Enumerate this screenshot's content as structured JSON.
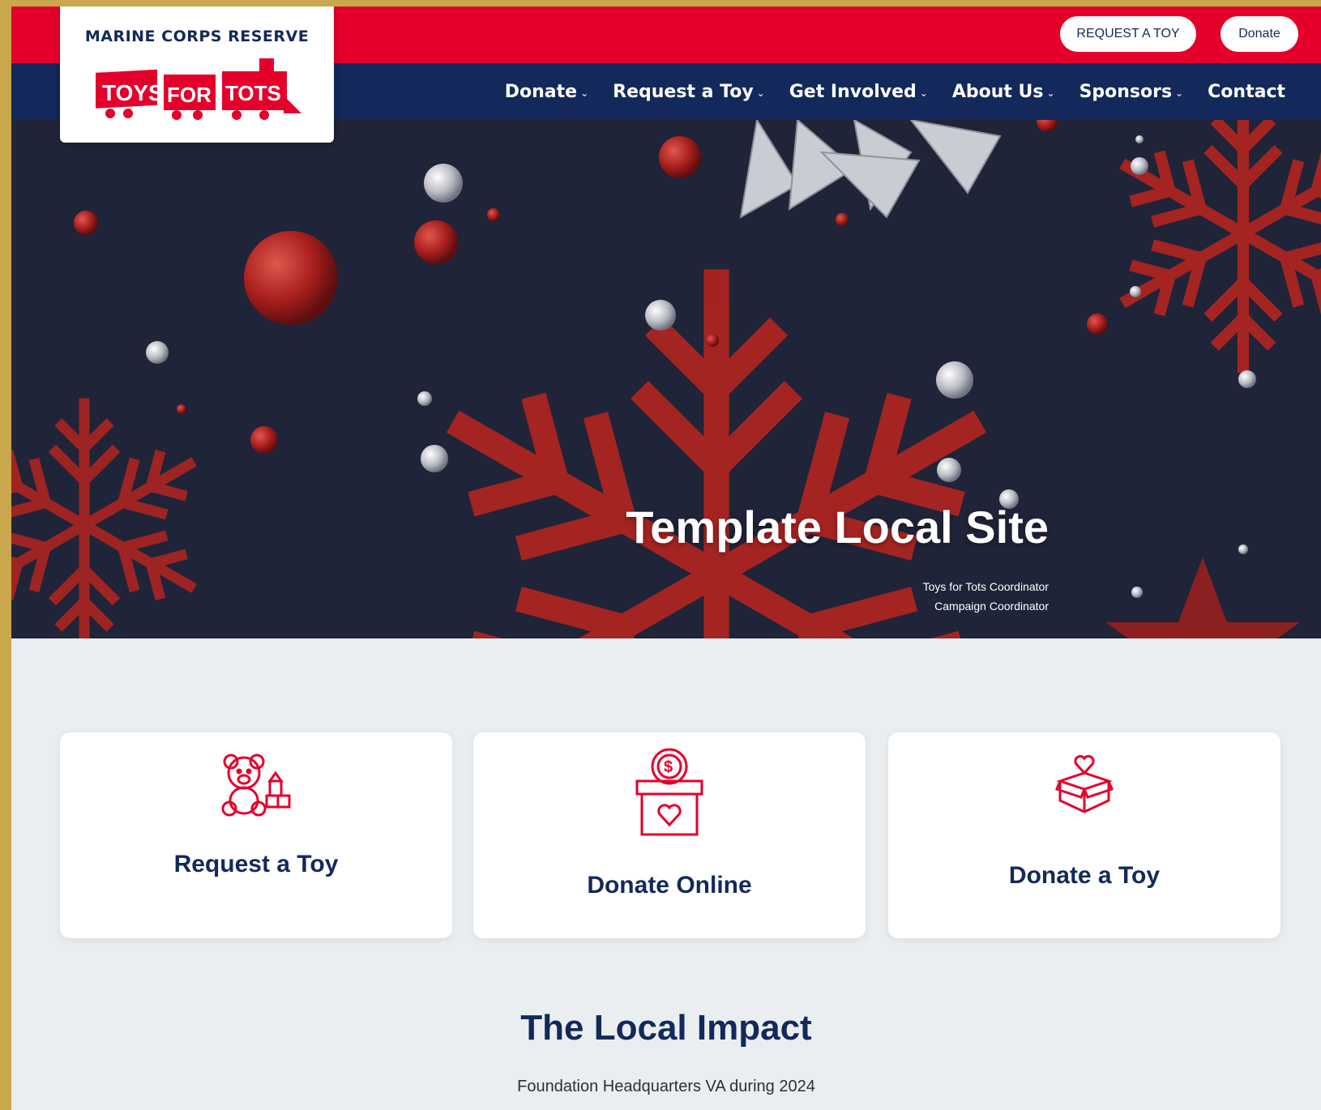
{
  "utility": {
    "request_label": "REQUEST A TOY",
    "donate_label": "Donate"
  },
  "logo": {
    "top_text": "MARINE CORPS RESERVE",
    "mark_text": [
      "TOYS",
      "FOR",
      "TOTS"
    ]
  },
  "nav": [
    {
      "label": "Donate",
      "dropdown": true
    },
    {
      "label": "Request a Toy",
      "dropdown": true
    },
    {
      "label": "Get Involved",
      "dropdown": true
    },
    {
      "label": "About Us",
      "dropdown": true
    },
    {
      "label": "Sponsors",
      "dropdown": true
    },
    {
      "label": "Contact",
      "dropdown": false
    }
  ],
  "hero": {
    "title": "Template Local Site",
    "subtitle_lines": [
      "Toys for Tots Coordinator",
      "Campaign Coordinator"
    ]
  },
  "cards": [
    {
      "title": "Request a Toy",
      "icon": "teddy-bear-icon"
    },
    {
      "title": "Donate Online",
      "icon": "donation-box-icon"
    },
    {
      "title": "Donate a Toy",
      "icon": "gift-heart-icon"
    }
  ],
  "impact": {
    "title": "The Local Impact",
    "subtitle": "Foundation Headquarters VA during 2024"
  },
  "colors": {
    "red": "#e4002b",
    "navy": "#13295b",
    "hero_bg": "#1f2438",
    "page_bg": "#ebeef1"
  }
}
